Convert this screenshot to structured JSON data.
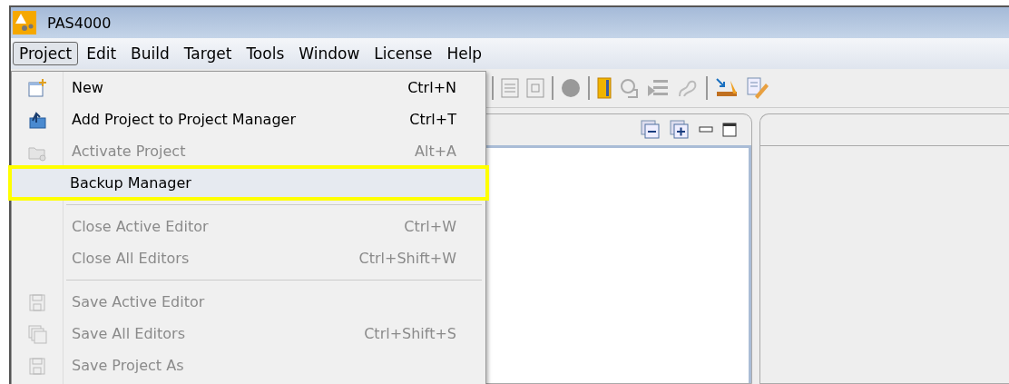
{
  "window": {
    "title": "PAS4000"
  },
  "menu_bar": [
    {
      "label": "Project",
      "selected": true
    },
    {
      "label": "Edit",
      "selected": false
    },
    {
      "label": "Build",
      "selected": false
    },
    {
      "label": "Target",
      "selected": false
    },
    {
      "label": "Tools",
      "selected": false
    },
    {
      "label": "Window",
      "selected": false
    },
    {
      "label": "License",
      "selected": false
    },
    {
      "label": "Help",
      "selected": false
    }
  ],
  "project_menu": [
    {
      "kind": "item",
      "label": "New",
      "shortcut": "Ctrl+N",
      "disabled": false,
      "selected": false
    },
    {
      "kind": "item",
      "label": "Add Project to Project Manager",
      "shortcut": "Ctrl+T",
      "disabled": false,
      "selected": false
    },
    {
      "kind": "item",
      "label": "Activate Project",
      "shortcut": "Alt+A",
      "disabled": true,
      "selected": false
    },
    {
      "kind": "item",
      "label": "Backup Manager",
      "disabled": false,
      "selected": true
    },
    {
      "kind": "separator"
    },
    {
      "kind": "item",
      "label": "Close Active Editor",
      "shortcut": "Ctrl+W",
      "disabled": true,
      "selected": false
    },
    {
      "kind": "item",
      "label": "Close All Editors",
      "shortcut": "Ctrl+Shift+W",
      "disabled": true,
      "selected": false
    },
    {
      "kind": "separator"
    },
    {
      "kind": "item",
      "label": "Save Active Editor",
      "disabled": true,
      "selected": false
    },
    {
      "kind": "item",
      "label": "Save All Editors",
      "shortcut": "Ctrl+Shift+S",
      "disabled": true,
      "selected": false
    },
    {
      "kind": "item",
      "label": "Save Project As",
      "disabled": true,
      "selected": false
    }
  ]
}
